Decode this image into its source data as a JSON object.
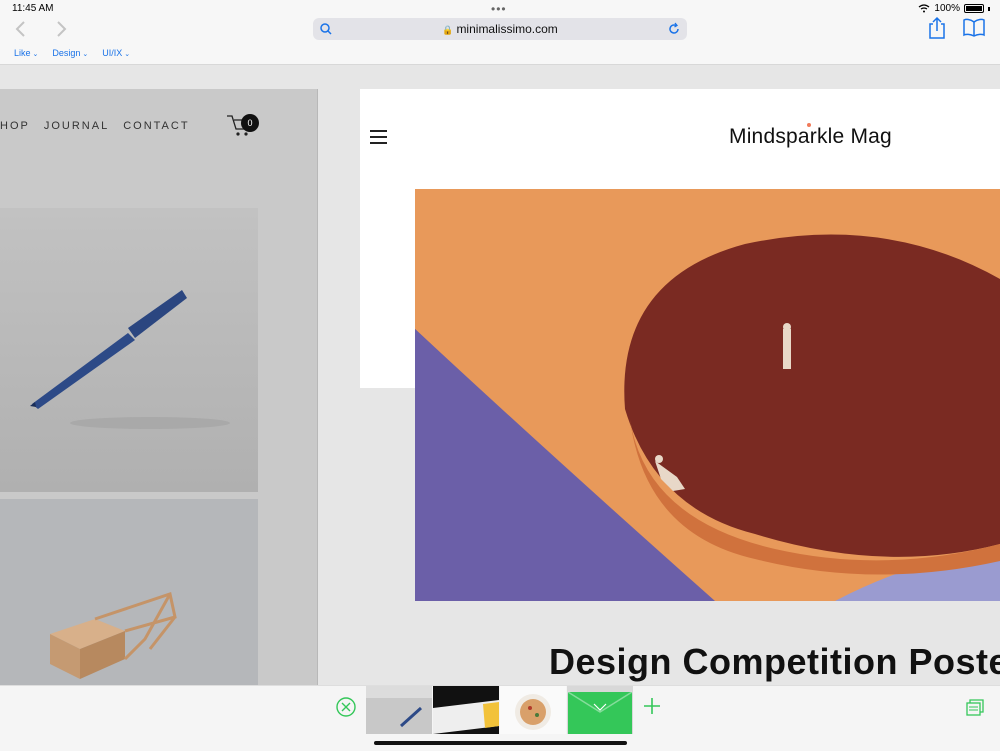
{
  "status": {
    "time": "11:45 AM",
    "battery": "100%"
  },
  "toolbar": {
    "url": "minimalissimo.com",
    "bookmarks": [
      {
        "label": "Like"
      },
      {
        "label": "Design"
      },
      {
        "label": "UI/IX"
      }
    ]
  },
  "left_page": {
    "nav": [
      "HOP",
      "JOURNAL",
      "CONTACT"
    ],
    "cart_count": "0"
  },
  "right_page": {
    "site_title": "Mindsparkle Mag",
    "headline": "Design Competition Poste"
  },
  "colors": {
    "accent": "#1a73e8",
    "tab_green": "#34c759",
    "hero_orange": "#e8995a",
    "hero_purple": "#6b5fa8"
  }
}
